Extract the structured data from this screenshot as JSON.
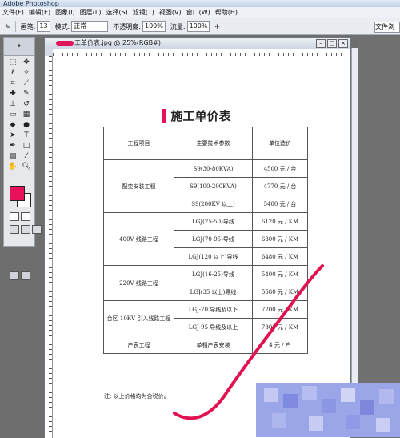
{
  "app": {
    "title": "Adobe Photoshop"
  },
  "menu": [
    "文件(F)",
    "编辑(E)",
    "图象(I)",
    "图层(L)",
    "选择(S)",
    "滤镜(T)",
    "视图(V)",
    "窗口(W)",
    "帮助(H)"
  ],
  "options": {
    "brush_label": "画笔:",
    "brush_size": "13",
    "mode_label": "模式:",
    "mode_value": "正常",
    "opacity_label": "不透明度:",
    "opacity_value": "100%",
    "flow_label": "流量:",
    "flow_value": "100%",
    "doc_button": "文件浏"
  },
  "document": {
    "tab_title": "工单价表.jpg @ 25%(RGB#)",
    "heading": "施工单价表",
    "heading_prefix": "▌",
    "table": {
      "headers": [
        "工程项目",
        "主要技术参数",
        "单位造价"
      ],
      "groups": [
        {
          "project": "配变安装工程",
          "rows": [
            [
              "S9(30-80KVA)",
              "4500 元 / 台"
            ],
            [
              "S9(100-200KVA)",
              "4770 元 / 台"
            ],
            [
              "S9(200KV 以上)",
              "5400 元 / 台"
            ]
          ]
        },
        {
          "project": "400V 线路工程",
          "rows": [
            [
              "LGJ(25-50)导线",
              "6120 元 / KM"
            ],
            [
              "LGJ(70-95)导线",
              "6300 元 / KM"
            ],
            [
              "LGJ(120 以上)导线",
              "6480 元 / KM"
            ]
          ]
        },
        {
          "project": "220V 线路工程",
          "rows": [
            [
              "LGJ(16-25)导线",
              "5400 元 / KM"
            ],
            [
              "LGJ(35 以上)导线",
              "5580 元 / KM"
            ]
          ]
        },
        {
          "project": "台区 10KV 引入线路工程",
          "rows": [
            [
              "LGJ-70 导线及以下",
              "7200 元 / KM"
            ],
            [
              "LGJ-95 导线及以上",
              "7800 元 / KM"
            ]
          ]
        },
        {
          "project": "户表工程",
          "rows": [
            [
              "单相户表安装",
              "4 元 / 户"
            ]
          ]
        }
      ]
    },
    "note": "注: 以上价格均为含税价。"
  },
  "colors": {
    "foreground": "#e8115a",
    "background": "#ffffff",
    "stroke": "#e0124f"
  }
}
